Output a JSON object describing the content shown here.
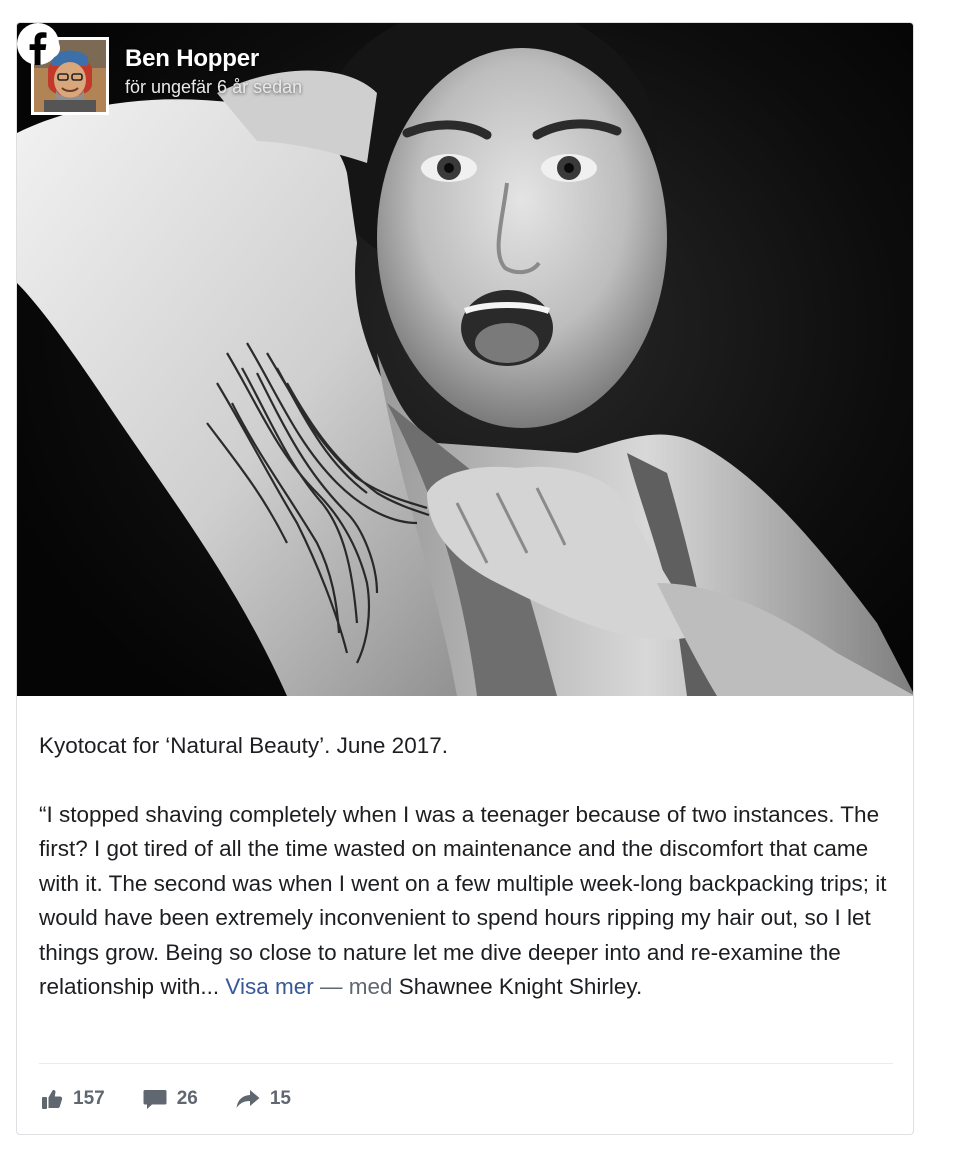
{
  "post": {
    "author": "Ben Hopper",
    "timestamp": "för ungefär 6 år sedan",
    "caption": "Kyotocat for ‘Natural Beauty’. June 2017.",
    "quote": "“I stopped shaving completely when I was a teenager because of two instances. The first? I got tired of all the time wasted on maintenance and the discomfort that came with it. The second was when I went on a few multiple week-long backpacking trips; it would have been extremely inconvenient to spend hours ripping my hair out, so I let things grow. Being so close to nature let me dive deeper into and re-examine the relationship with...",
    "see_more": "Visa mer",
    "with_separator": " — med ",
    "tagged_person": "Shawnee Knight Shirley",
    "end_punct": ".",
    "icons": {
      "verified": "verified-badge-icon",
      "platform": "facebook-logo-icon",
      "like": "thumbs-up-icon",
      "comment": "comment-bubble-icon",
      "share": "share-arrow-icon"
    }
  },
  "stats": {
    "likes": "157",
    "comments": "26",
    "shares": "15"
  },
  "colors": {
    "link": "#385898",
    "text": "#1c1e21",
    "muted": "#606770",
    "border": "#dddfe2"
  }
}
